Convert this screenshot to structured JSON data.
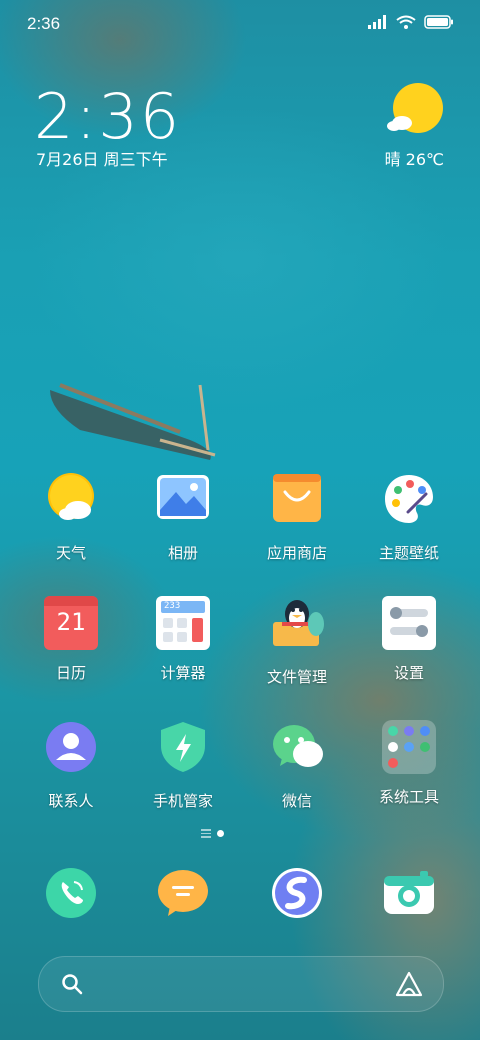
{
  "status_bar": {
    "time": "2:36"
  },
  "clock_widget": {
    "time": "2:36",
    "date": "7月26日 周三下午"
  },
  "weather": {
    "text": "晴 26℃"
  },
  "apps": [
    {
      "name": "天气",
      "icon": "weather-icon"
    },
    {
      "name": "相册",
      "icon": "gallery-icon"
    },
    {
      "name": "应用商店",
      "icon": "app-store-icon"
    },
    {
      "name": "主题壁纸",
      "icon": "themes-icon"
    },
    {
      "name": "日历",
      "icon": "calendar-icon",
      "badge": "21"
    },
    {
      "name": "计算器",
      "icon": "calculator-icon",
      "badge": "233"
    },
    {
      "name": "文件管理",
      "icon": "file-manager-icon"
    },
    {
      "name": "设置",
      "icon": "settings-icon"
    },
    {
      "name": "联系人",
      "icon": "contacts-icon"
    },
    {
      "name": "手机管家",
      "icon": "security-icon"
    },
    {
      "name": "微信",
      "icon": "wechat-icon"
    },
    {
      "name": "系统工具",
      "icon": "system-tools-folder-icon"
    }
  ],
  "dock": [
    "phone-icon",
    "messages-icon",
    "browser-icon",
    "camera-icon"
  ],
  "search": {
    "icon": "search-icon",
    "assistant_icon": "assistant-icon"
  },
  "colors": {
    "weather_sun": "#FFD21E",
    "calendar_red": "#F25C5C",
    "contacts_purple": "#7A7CF2",
    "security_green": "#48D6A8",
    "camera_teal": "#3BC9B0"
  }
}
